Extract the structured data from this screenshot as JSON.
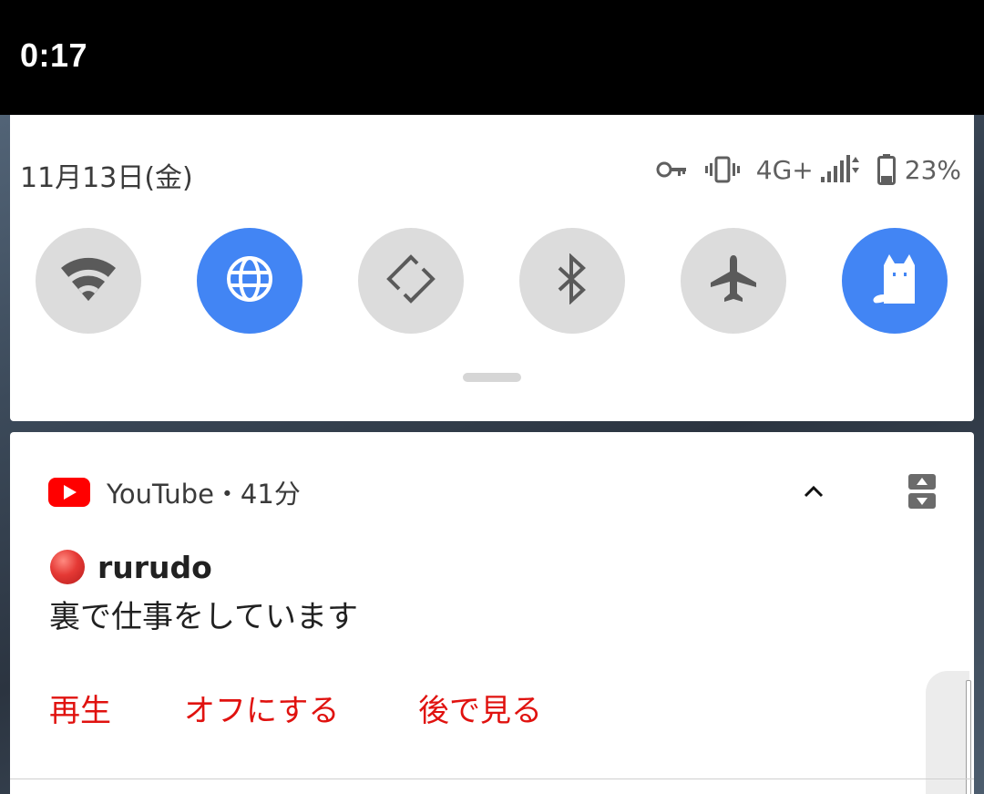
{
  "status_bar": {
    "time": "0:17"
  },
  "quick_settings": {
    "date": "11月13日(金)",
    "network": "4G+",
    "battery": "23%",
    "tiles": [
      {
        "name": "wifi",
        "active": false
      },
      {
        "name": "globe",
        "active": true
      },
      {
        "name": "auto-rotate",
        "active": false
      },
      {
        "name": "bluetooth",
        "active": false
      },
      {
        "name": "airplane",
        "active": false
      },
      {
        "name": "cat",
        "active": true
      }
    ]
  },
  "notification": {
    "app_name": "YouTube・41分",
    "title": "rurudo",
    "body": "裏で仕事をしています",
    "actions": [
      "再生",
      "オフにする",
      "後で見る"
    ]
  },
  "colors": {
    "accent": "#4285f4",
    "action_text": "#e0120f",
    "youtube_red": "#ff0000"
  }
}
